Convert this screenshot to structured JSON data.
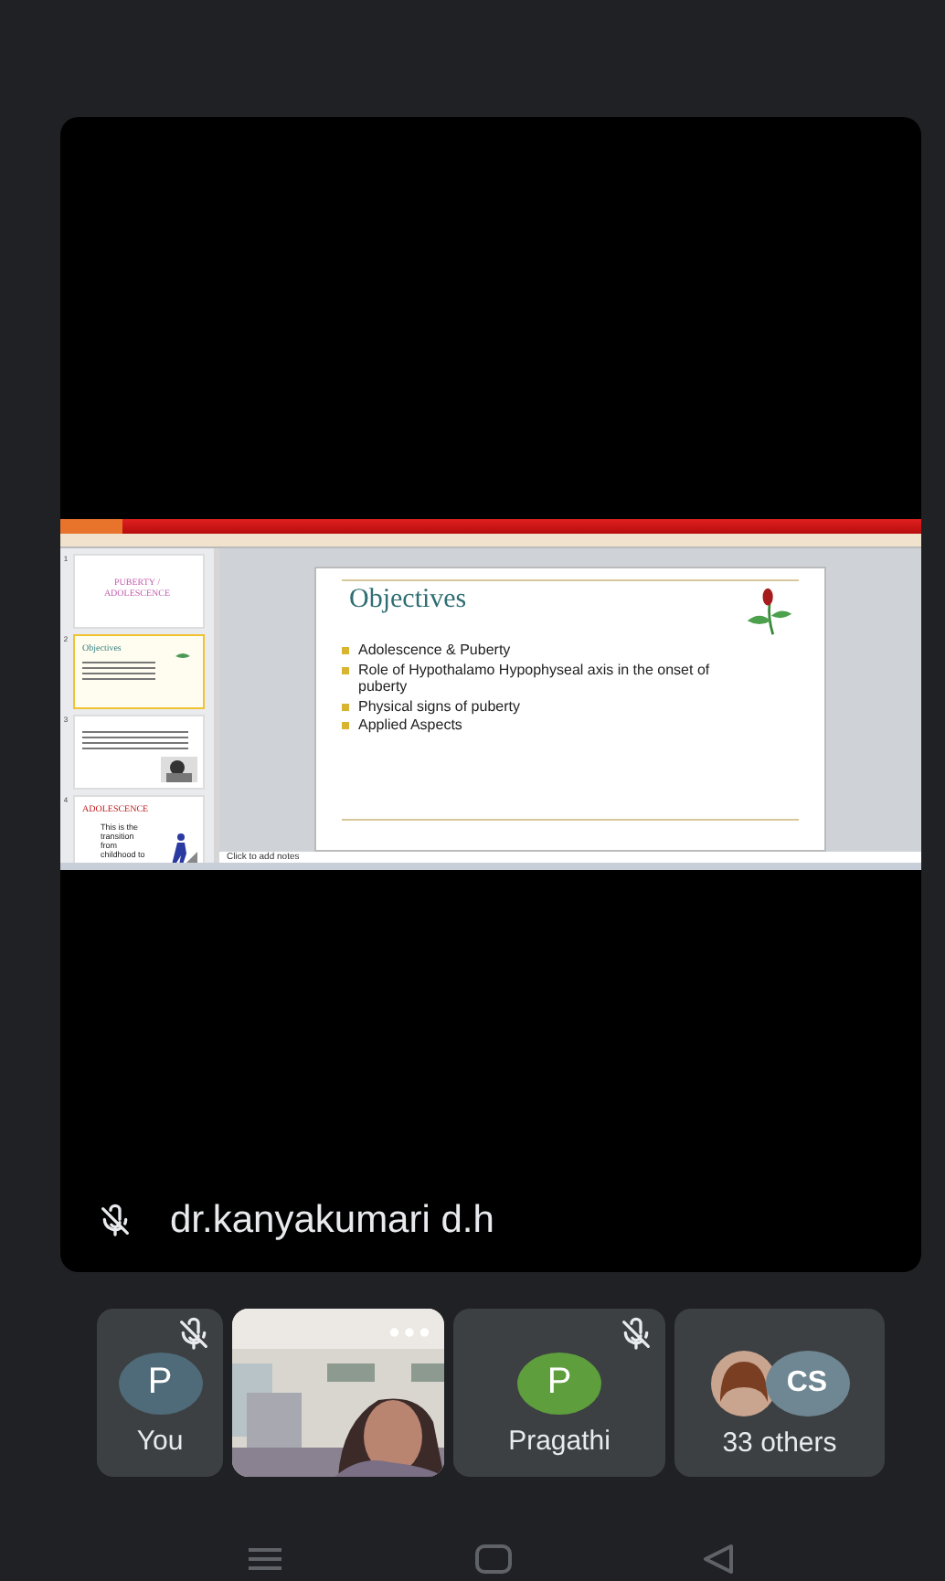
{
  "main_tile": {
    "speaker": "dr.kanyakumari d.h",
    "muted": true,
    "shared_screen": {
      "thumbnails": [
        {
          "number": "1",
          "title": "PUBERTY / ADOLESCENCE",
          "selected": false,
          "kind": "title"
        },
        {
          "number": "2",
          "title": "Objectives",
          "selected": true,
          "kind": "list"
        },
        {
          "number": "3",
          "selected": false,
          "kind": "quote"
        },
        {
          "number": "4",
          "title": "ADOLESCENCE",
          "body": "This is the transition from childhood to",
          "selected": false,
          "kind": "text"
        }
      ],
      "slide": {
        "title": "Objectives",
        "bullets": [
          "Adolescence & Puberty",
          "Role of Hypothalamo Hypophyseal axis in the onset of puberty",
          "Physical signs of puberty",
          "Applied Aspects"
        ]
      },
      "notes_placeholder": "Click to add notes"
    }
  },
  "participants": [
    {
      "kind": "avatar",
      "name": "You",
      "initial": "P",
      "color": "#4f6a78",
      "muted": true
    },
    {
      "kind": "camera",
      "muted": false
    },
    {
      "kind": "avatar",
      "name": "Pragathi",
      "initial": "P",
      "color": "#5e9e3c",
      "muted": true
    },
    {
      "kind": "group",
      "name": "33 others",
      "initial": "CS",
      "color": "#6f8793",
      "muted": false
    }
  ]
}
